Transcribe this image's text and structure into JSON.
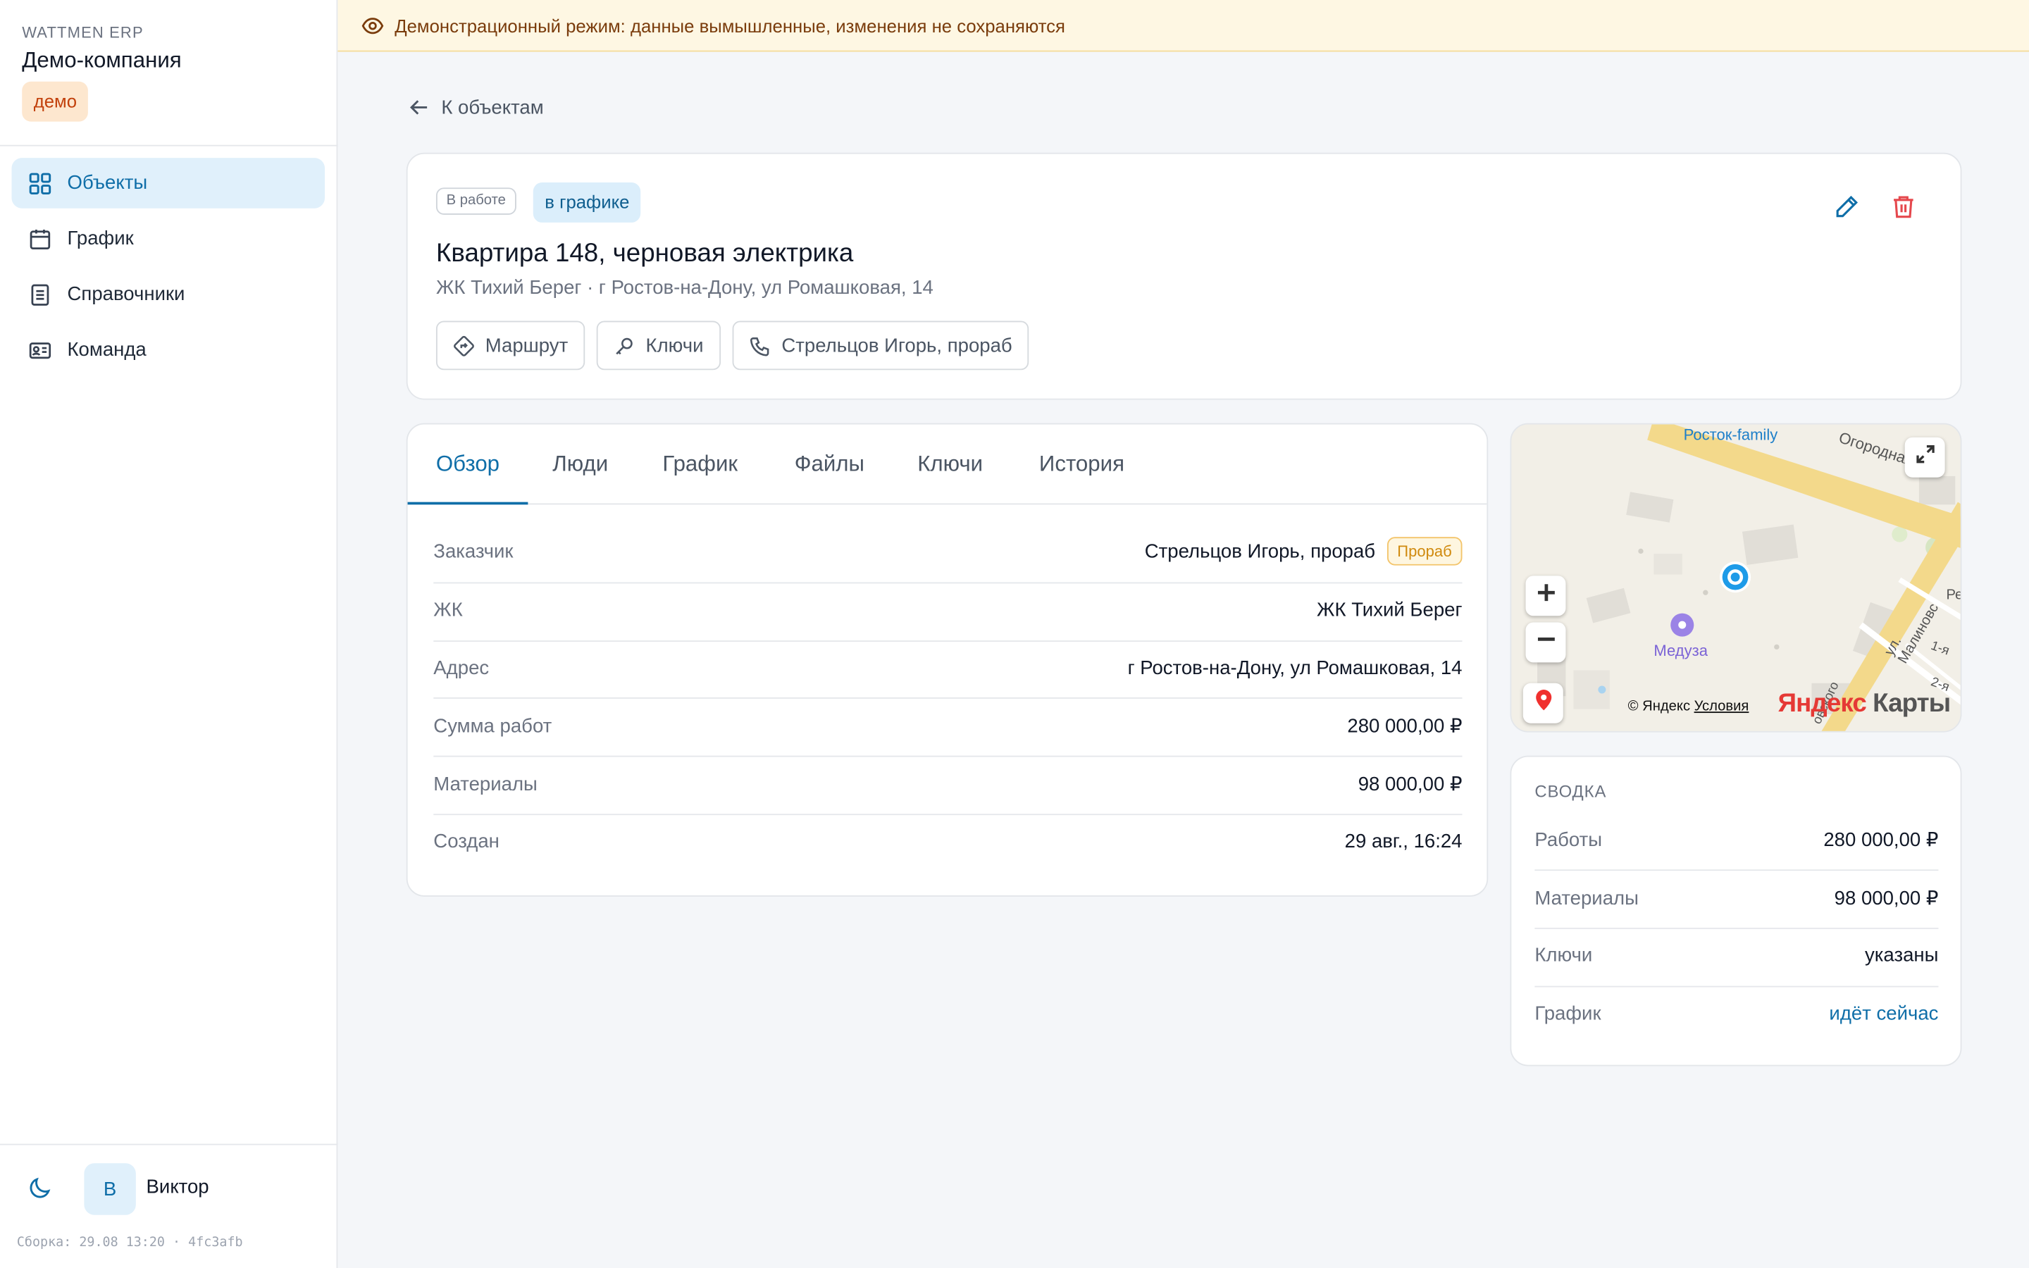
{
  "sidebar": {
    "brand": "WATTMEN ERP",
    "company": "Демо-компания",
    "badge": "демо",
    "items": [
      {
        "label": "Объекты",
        "icon": "grid-icon",
        "active": true
      },
      {
        "label": "График",
        "icon": "calendar-icon"
      },
      {
        "label": "Справочники",
        "icon": "document-icon"
      },
      {
        "label": "Команда",
        "icon": "id-card-icon"
      }
    ],
    "user": {
      "initial": "В",
      "name": "Виктор"
    },
    "build": "Сборка: 29.08 13:20 · 4fc3afb"
  },
  "banner": {
    "text": "Демонстрационный режим: данные вымышленные, изменения не сохраняются",
    "icon": "eye-icon"
  },
  "back_link": "К объектам",
  "object": {
    "status": "В работе",
    "schedule_status": "в графике",
    "title": "Квартира 148, черновая электрика",
    "subtitle": "ЖК Тихий Берег · г Ростов-на-Дону, ул Ромашковая, 14",
    "actions": [
      {
        "label": "Маршрут",
        "icon": "route-icon"
      },
      {
        "label": "Ключи",
        "icon": "key-icon"
      },
      {
        "label": "Стрельцов Игорь, прораб",
        "icon": "phone-icon"
      }
    ]
  },
  "tabs": [
    "Обзор",
    "Люди",
    "График",
    "Файлы",
    "Ключи",
    "История"
  ],
  "overview": [
    {
      "label": "Заказчик",
      "value": "Стрельцов Игорь, прораб",
      "badge": "Прораб"
    },
    {
      "label": "ЖК",
      "value": "ЖК Тихий Берег"
    },
    {
      "label": "Адрес",
      "value": "г Ростов-на-Дону, ул Ромашковая, 14"
    },
    {
      "label": "Сумма работ",
      "value": "280 000,00 ₽"
    },
    {
      "label": "Материалы",
      "value": "98 000,00 ₽"
    },
    {
      "label": "Создан",
      "value": "29 авг., 16:24"
    }
  ],
  "map": {
    "labels": {
      "poi_family": "Росток-family",
      "street_ogorodnaya": "Огородная",
      "street_malinovskogo": "ул. Малиновс",
      "street_re": "Ре",
      "street_1ya": "1-я",
      "street_2ya": "2-я",
      "street_ovogo": "овского",
      "poi_meduza": "Медуза"
    },
    "attribution_prefix": "© Яндекс",
    "attribution_link": "Условия",
    "logo_brand": "Яндекс",
    "logo_rest": " Карты"
  },
  "summary": {
    "title": "СВОДКА",
    "rows": [
      {
        "label": "Работы",
        "value": "280 000,00 ₽"
      },
      {
        "label": "Материалы",
        "value": "98 000,00 ₽"
      },
      {
        "label": "Ключи",
        "value": "указаны"
      },
      {
        "label": "График",
        "value": "идёт сейчас",
        "link": true
      }
    ]
  },
  "colors": {
    "accent": "#0f6ea8",
    "danger": "#e5484d",
    "banner_bg": "#fef7e3",
    "demo_badge": "#fde7cf"
  }
}
